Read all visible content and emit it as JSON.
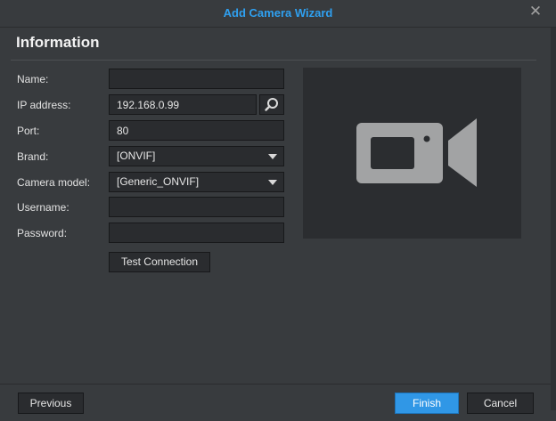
{
  "window": {
    "title": "Add Camera Wizard",
    "close_icon": "close-icon"
  },
  "section": {
    "heading": "Information"
  },
  "form": {
    "name": {
      "label": "Name:",
      "value": ""
    },
    "ip": {
      "label": "IP address:",
      "value": "192.168.0.99",
      "search_icon": "search-icon"
    },
    "port": {
      "label": "Port:",
      "value": "80"
    },
    "brand": {
      "label": "Brand:",
      "value": "[ONVIF]"
    },
    "model": {
      "label": "Camera model:",
      "value": "[Generic_ONVIF]"
    },
    "username": {
      "label": "Username:",
      "value": ""
    },
    "password": {
      "label": "Password:",
      "value": ""
    },
    "test_button": "Test Connection"
  },
  "preview": {
    "icon": "video-camera-icon"
  },
  "footer": {
    "previous": "Previous",
    "finish": "Finish",
    "cancel": "Cancel"
  },
  "colors": {
    "accent": "#3097e6",
    "title": "#2fa0f0",
    "background": "#383b3e",
    "field": "#2a2c2f"
  }
}
